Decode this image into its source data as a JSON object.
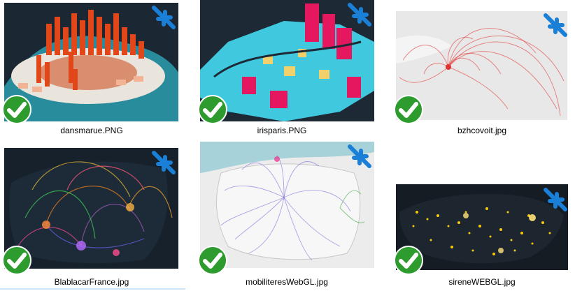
{
  "files": [
    {
      "name": "dansmarue.PNG"
    },
    {
      "name": "irisparis.PNG"
    },
    {
      "name": "bzhcovoit.jpg"
    },
    {
      "name": "BlablacarFrance.jpg"
    },
    {
      "name": "mobiliteresWebGL.jpg"
    },
    {
      "name": "sireneWEBGL.jpg"
    }
  ],
  "status_icon": "green-check-icon",
  "sync_icon": "blue-sync-arrows-icon",
  "colors": {
    "check_green": "#2e9b2e",
    "sync_blue": "#1a7fd6",
    "map_dark": "#14202b",
    "accent_orange": "#e2471a",
    "accent_cyan": "#3fc8de",
    "accent_red": "#e03030",
    "accent_yellow": "#f6c90e"
  }
}
